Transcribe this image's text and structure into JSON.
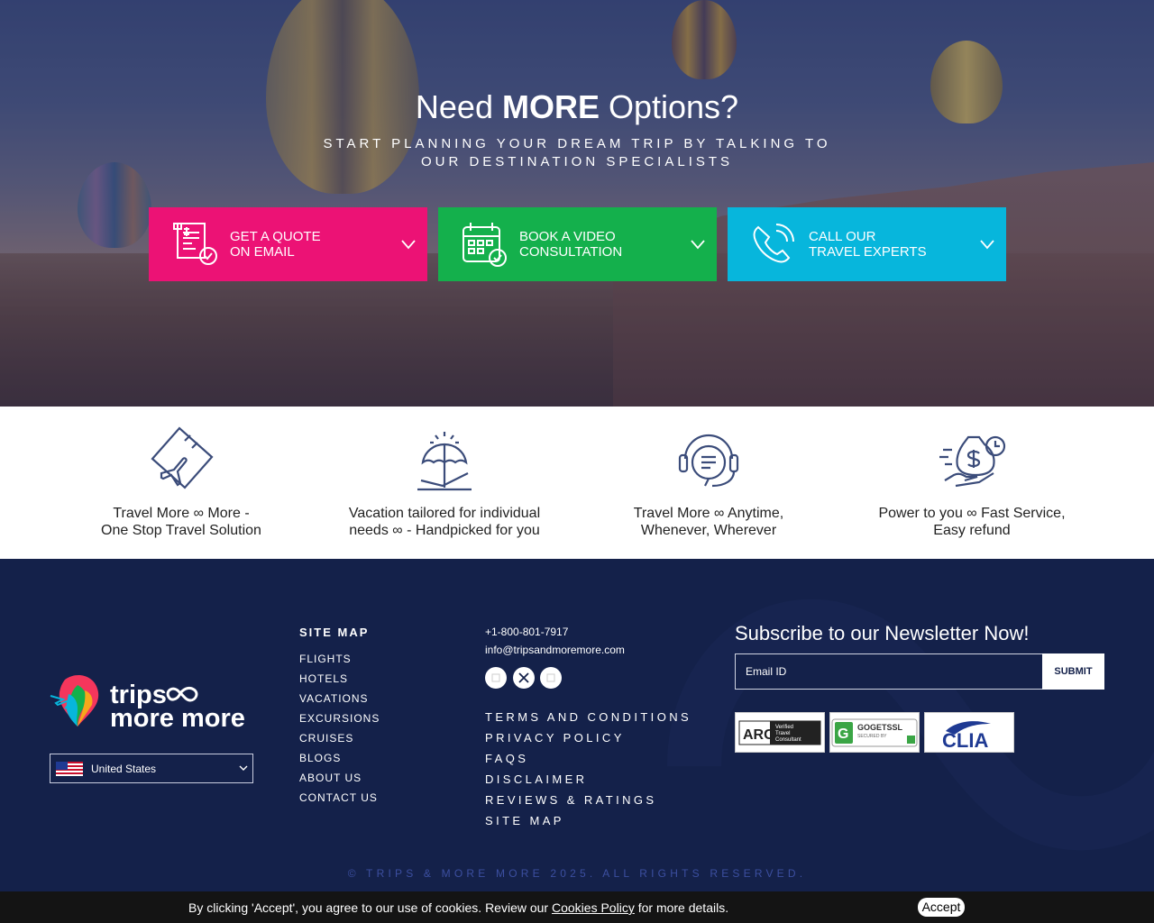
{
  "hero": {
    "title_pre": "Need ",
    "title_bold": "MORE",
    "title_post": " Options?",
    "subtitle": "START PLANNING YOUR DREAM TRIP BY TALKING TO OUR DESTINATION SPECIALISTS",
    "ctas": [
      {
        "line1": "GET A QUOTE",
        "line2": "ON EMAIL",
        "color": "#ec1275"
      },
      {
        "line1": "BOOK A VIDEO",
        "line2": "CONSULTATION",
        "color": "#14b04c"
      },
      {
        "line1": "CALL OUR",
        "line2": "TRAVEL EXPERTS",
        "color": "#07b6dc"
      }
    ]
  },
  "features": [
    {
      "line1": "Travel More ∞ More -",
      "line2": "One Stop Travel Solution",
      "icon": "plane-ticket-icon"
    },
    {
      "line1": "Vacation tailored for individual",
      "line2": "needs ∞ - Handpicked for you",
      "icon": "beach-umbrella-icon"
    },
    {
      "line1": "Travel More ∞ Anytime,",
      "line2": "Whenever, Wherever",
      "icon": "headset-support-icon"
    },
    {
      "line1": "Power to you ∞ Fast Service,",
      "line2": "Easy refund",
      "icon": "money-bag-hand-icon"
    }
  ],
  "footer": {
    "logo_line1": "trips",
    "logo_line2": "more more",
    "country": "United States",
    "sitemap_title": "SITE MAP",
    "sitemap": [
      "FLIGHTS",
      "HOTELS",
      "VACATIONS",
      "EXCURSIONS",
      "CRUISES",
      "BLOGS",
      "ABOUT US",
      "CONTACT US"
    ],
    "phone": "+1-800-801-7917",
    "email": "info@tripsandmoremore.com",
    "social": [
      "facebook-icon",
      "x-icon",
      "instagram-icon"
    ],
    "links": [
      "TERMS AND CONDITIONS",
      "PRIVACY POLICY",
      "FAQS",
      "DISCLAIMER",
      "REVIEWS & RATINGS",
      "SITE MAP"
    ],
    "newsletter_title": "Subscribe to our Newsletter Now!",
    "newsletter_placeholder": "Email ID",
    "submit": "SUBMIT",
    "badges": {
      "arc_text": "ARC",
      "arc_sub1": "Verified",
      "arc_sub2": "Travel",
      "arc_sub3": "Consultant",
      "ssl_text": "GOGETSSL",
      "ssl_sub": "SECURED BY",
      "clia_text": "CLIA"
    },
    "copyright": "© TRIPS & MORE MORE 2025. ALL RIGHTS RESERVED."
  },
  "cookie": {
    "text_pre": "By clicking 'Accept', you agree to our use of cookies. Review our ",
    "link": "Cookies Policy",
    "text_post": " for more details.",
    "accept": "Accept"
  },
  "colors": {
    "footer_bg": "#14214a",
    "pink": "#ec1275",
    "green": "#14b04c",
    "cyan": "#07b6dc"
  }
}
